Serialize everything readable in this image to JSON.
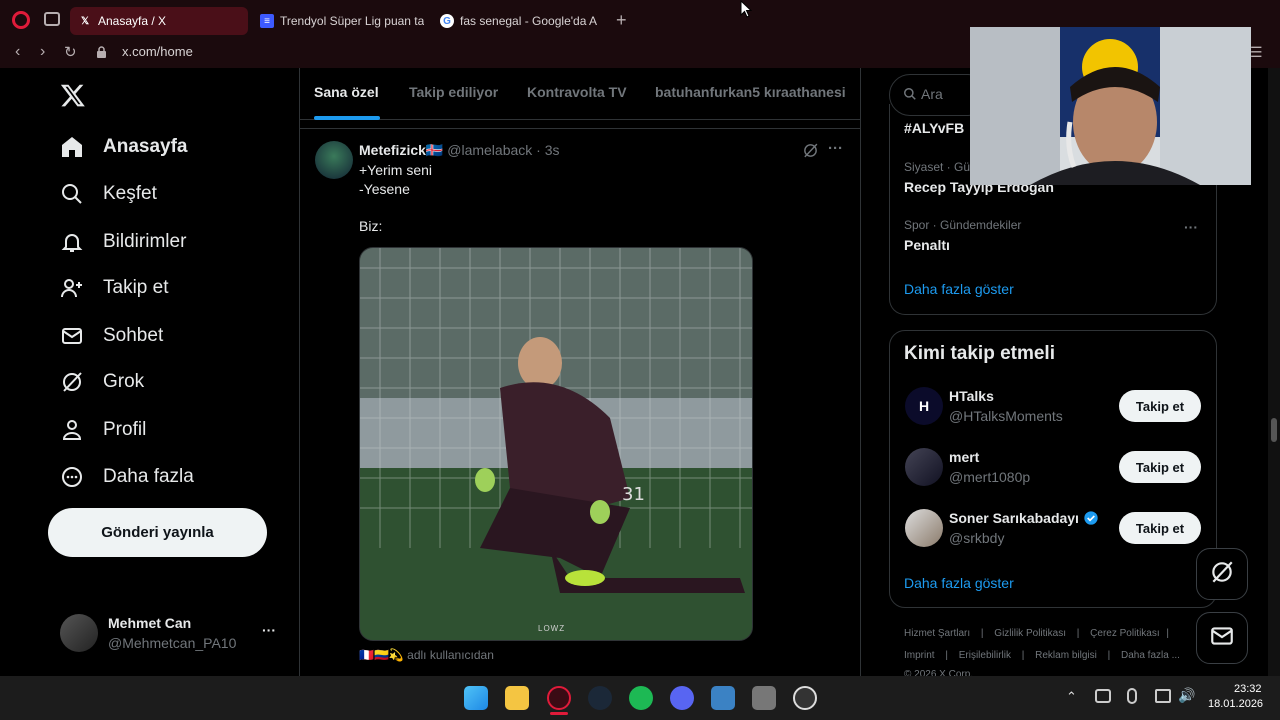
{
  "browser": {
    "tabs": [
      {
        "label": "Anasayfa / X",
        "active": true
      },
      {
        "label": "Trendyol Süper Lig puan ta"
      },
      {
        "label": "fas senegal - Google'da A"
      }
    ],
    "new_tab": "+",
    "url": "x.com/home"
  },
  "sidebar": {
    "items": [
      {
        "label": "Anasayfa",
        "icon": "home-icon"
      },
      {
        "label": "Keşfet",
        "icon": "search-icon"
      },
      {
        "label": "Bildirimler",
        "icon": "bell-icon"
      },
      {
        "label": "Takip et",
        "icon": "follow-icon"
      },
      {
        "label": "Sohbet",
        "icon": "mail-icon"
      },
      {
        "label": "Grok",
        "icon": "grok-icon"
      },
      {
        "label": "Profil",
        "icon": "user-icon"
      },
      {
        "label": "Daha fazla",
        "icon": "more-icon"
      }
    ],
    "post_button": "Gönderi yayınla",
    "account": {
      "name": "Mehmet Can",
      "handle": "@Mehmetcan_PA10",
      "more": "···"
    }
  },
  "timeline": {
    "tabs": [
      "Sana özel",
      "Takip ediliyor",
      "Kontravolta TV",
      "batuhanfurkan5 kıraathanesi"
    ],
    "post": {
      "name": "Metefizick",
      "flag": "🇮🇸",
      "handle": "@lamelaback",
      "time": "· 3s",
      "line1": "+Yerim seni",
      "line2": "-Yesene",
      "line3": "Biz:",
      "video_watermark": "LOWZ",
      "footer": "adlı kullanıcıdan"
    }
  },
  "right": {
    "search_placeholder": "Ara",
    "trends": [
      {
        "meta": "",
        "title": "#ALYvFB"
      },
      {
        "meta": "Siyaset · Gü",
        "title": "Recep Tayyip Erdoğan"
      },
      {
        "meta": "Spor · Gündemdekiler",
        "title": "Penaltı"
      }
    ],
    "show_more": "Daha fazla göster",
    "who_to_follow": {
      "title": "Kimi takip etmeli",
      "users": [
        {
          "name": "HTalks",
          "handle": "@HTalksMoments",
          "button": "Takip et"
        },
        {
          "name": "mert",
          "handle": "@mert1080p",
          "button": "Takip et"
        },
        {
          "name": "Soner Sarıkabadayı",
          "handle": "@srkbdy",
          "button": "Takip et",
          "verified": true
        }
      ],
      "show_more": "Daha fazla göster"
    },
    "footer_links": [
      "Hizmet Şartları",
      "Gizlilik Politikası",
      "Çerez Politikası",
      "Imprint",
      "Erişilebilirlik",
      "Reklam bilgisi",
      "Daha fazla ..."
    ],
    "copyright": "© 2026 X Corp."
  },
  "taskbar": {
    "time": "23:32",
    "date": "18.01.2026"
  },
  "colors": {
    "accent": "#1d9bf0",
    "browser_red": "#e01b3a"
  }
}
